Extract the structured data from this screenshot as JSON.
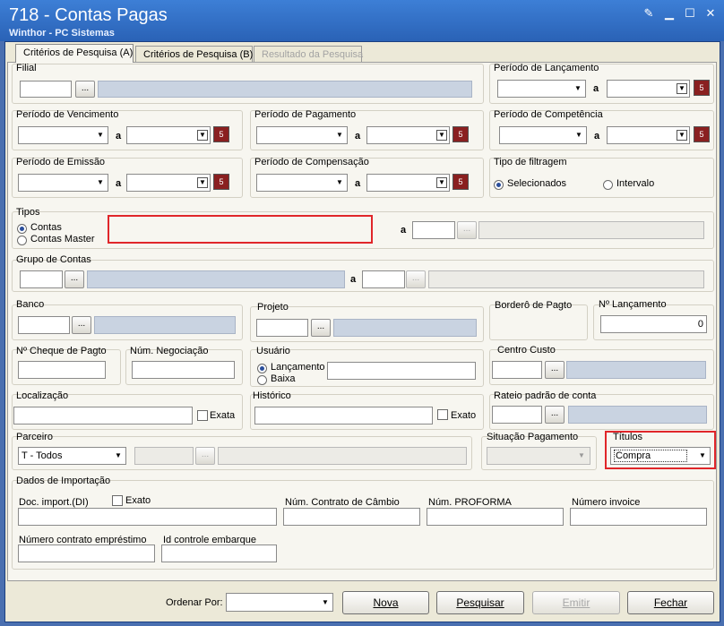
{
  "window": {
    "title": "718 - Contas Pagas",
    "subtitle": "Winthor - PC Sistemas",
    "min_icon": "minimize-icon",
    "restore_icon": "restore-icon",
    "close_icon": "close-icon"
  },
  "tabs": [
    {
      "label": "Critérios de Pesquisa (A)",
      "active": true
    },
    {
      "label": "Critérios de Pesquisa (B)",
      "active": false
    },
    {
      "label": "Resultado da Pesquisa",
      "disabled": true
    }
  ],
  "labels": {
    "filial": "Filial",
    "periodo_lancamento": "Período de Lançamento",
    "periodo_vencimento": "Período de Vencimento",
    "periodo_pagamento": "Período de Pagamento",
    "periodo_competencia": "Período de Competência",
    "periodo_emissao": "Período de Emissão",
    "periodo_compensacao": "Período de Compensação",
    "tipo_filtragem": "Tipo de filtragem",
    "selecionados": "Selecionados",
    "intervalo": "Intervalo",
    "tipos": "Tipos",
    "contas": "Contas",
    "contas_master": "Contas Master",
    "grupo_contas": "Grupo de Contas",
    "banco": "Banco",
    "projeto": "Projeto",
    "bordero": "Borderô de Pagto",
    "n_lancamento": "Nº Lançamento",
    "n_cheque": "Nº Cheque de Pagto",
    "num_negociacao": "Núm. Negociação",
    "usuario": "Usuário",
    "lancamento": "Lançamento",
    "baixa": "Baixa",
    "centro_custo": "Centro Custo",
    "localizacao": "Localização",
    "exata": "Exata",
    "historico": "Histórico",
    "exato_hist": "Exato",
    "rateio": "Rateio padrão de conta",
    "parceiro": "Parceiro",
    "situacao_pagamento": "Situação Pagamento",
    "titulos": "Títulos",
    "dados_importacao": "Dados de Importação",
    "doc_import": "Doc. import.(DI)",
    "exato": "Exato",
    "num_contrato_cambio": "Núm. Contrato de Câmbio",
    "num_proforma": "Núm. PROFORMA",
    "numero_invoice": "Número invoice",
    "numero_contrato_emprestimo": "Número contrato empréstimo",
    "id_controle_embarque": "Id controle embarque",
    "a": "a",
    "ellipsis": "..."
  },
  "values": {
    "n_lancamento": "0",
    "parceiro": "T - Todos",
    "titulos": "Compra"
  },
  "bottom": {
    "ordenar_por": "Ordenar Por:",
    "nova": "Nova",
    "pesquisar": "Pesquisar",
    "emitir": "Emitir",
    "fechar": "Fechar"
  },
  "colors": {
    "accent": "#2a62b6",
    "highlight": "#e0262a"
  }
}
